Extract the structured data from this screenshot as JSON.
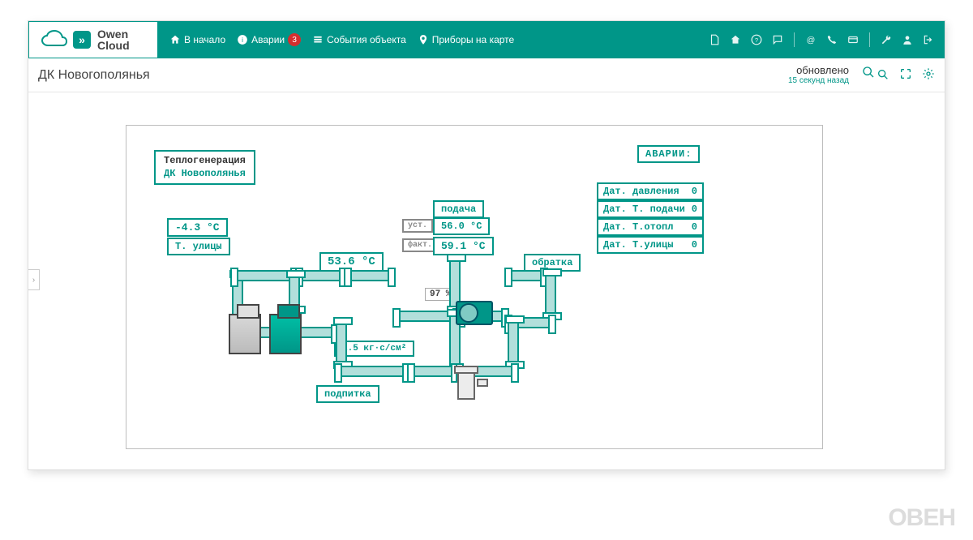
{
  "logo": {
    "line1": "Owen",
    "line2": "Cloud"
  },
  "nav": {
    "home": "В начало",
    "alarms": "Аварии",
    "alarms_badge": "3",
    "events": "События объекта",
    "map": "Приборы на карте"
  },
  "page": {
    "title": "ДК Новогополянья",
    "update_label": "обновлено",
    "update_time": "15 секунд назад"
  },
  "diagram": {
    "title1": "Теплогенерация",
    "title2": "ДК Новополянья",
    "outdoor_temp": "-4.3 °C",
    "outdoor_label": "Т. улицы",
    "t_536": "53.6 °C",
    "podacha_label": "подача",
    "ust_label": "уст.",
    "ust_value": "56.0 °C",
    "fakt_label": "факт.",
    "fakt_value": "59.1 °C",
    "obratka_label": "обратка",
    "percent": "97 %",
    "pressure": "1.5 кг·с/см²",
    "podpitka_label": "подпитка",
    "alarms_title": "АВАРИИ:",
    "alarms": [
      {
        "label": "Дат. давления",
        "value": "0"
      },
      {
        "label": "Дат. Т. подачи",
        "value": "0"
      },
      {
        "label": "Дат. Т.отопл",
        "value": "0"
      },
      {
        "label": "Дат. Т.улицы",
        "value": "0"
      }
    ]
  },
  "watermark": "ОВЕН"
}
